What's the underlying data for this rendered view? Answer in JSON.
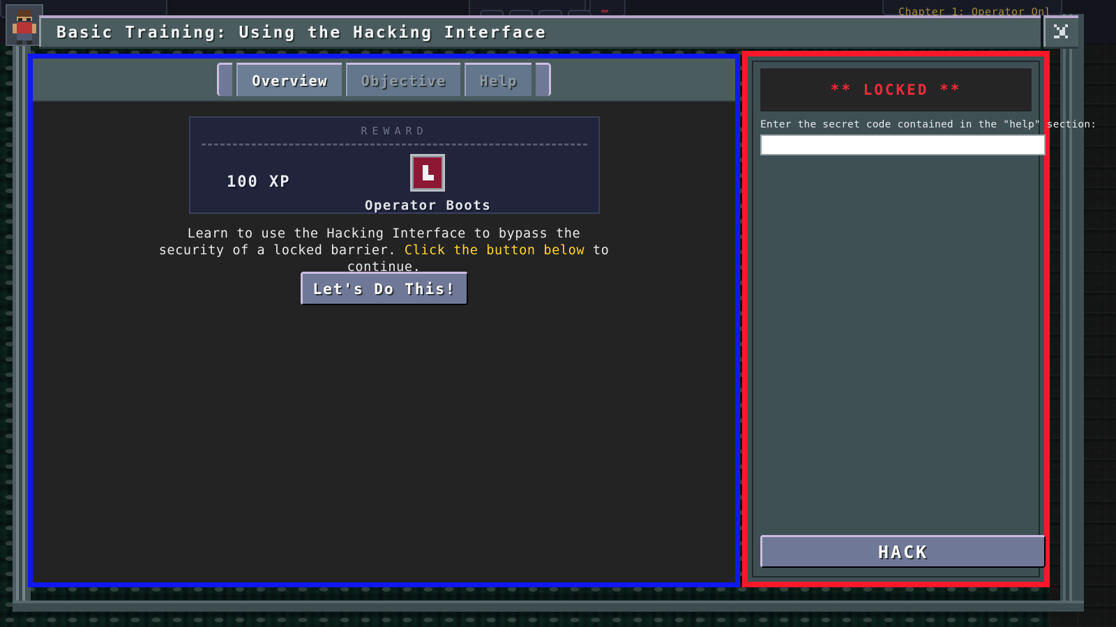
{
  "window": {
    "title": "Basic Training: Using the Hacking Interface",
    "close_label": "close-window",
    "avatar_label": "player-avatar"
  },
  "background_hud": {
    "chapter_label": "Chapter 1: Operator Onl"
  },
  "quest_panel": {
    "border_color": "#0f18f0",
    "tabs": [
      {
        "label": "Overview",
        "active": true
      },
      {
        "label": "Objective",
        "active": false
      },
      {
        "label": "Help",
        "active": false
      }
    ],
    "tab_scroll_left": "◄",
    "tab_scroll_right": "►",
    "reward": {
      "header": "REWARD",
      "xp": "100 XP",
      "item_name": "Operator Boots",
      "item_icon": "boot-icon",
      "item_icon_color": "#8c1834",
      "panel_color": "#21243a"
    },
    "description_line1": "Learn to use the Hacking Interface to bypass the security of a",
    "description_line2_pre": "locked barrier. ",
    "description_highlight": "Click the button below",
    "description_line2_post": " to continue.",
    "highlight_color": "#ffd52e",
    "action_button": "Let's Do This!"
  },
  "hack_panel": {
    "border_color": "#f8182a",
    "status": "** LOCKED **",
    "status_color": "#ef2b3a",
    "prompt": "Enter the secret code contained in the \"help\" section:",
    "input_value": "",
    "input_placeholder": "",
    "submit_label": "HACK"
  }
}
